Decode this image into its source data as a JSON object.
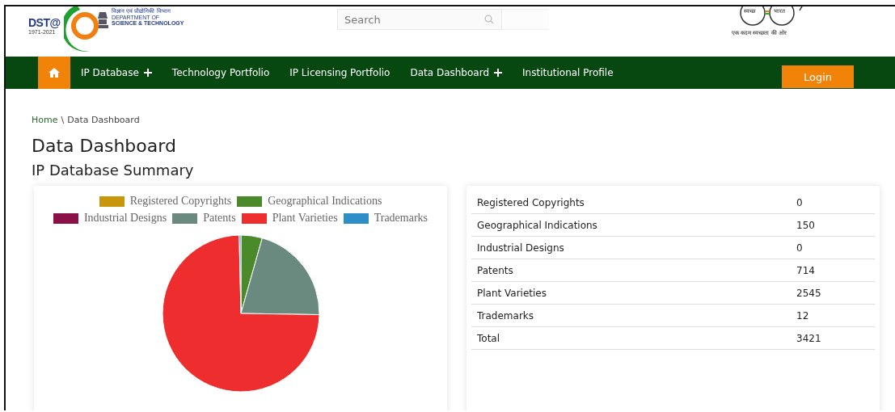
{
  "header": {
    "logo": {
      "badge": "DST@",
      "years": "1971-2021",
      "hindi": "विज्ञान एवं प्रौद्योगिकी विभाग",
      "line1": "DEPARTMENT OF",
      "line2": "SCIENCE & TECHNOLOGY"
    },
    "search": {
      "placeholder": "Search"
    },
    "swachh": {
      "word1": "स्वच्छ",
      "word2": "भारत",
      "tagline": "एक कदम स्वच्छता की ओर"
    }
  },
  "nav": {
    "items": [
      {
        "label": "IP Database",
        "expandable": true
      },
      {
        "label": "Technology Portfolio",
        "expandable": false
      },
      {
        "label": "IP Licensing Portfolio",
        "expandable": false
      },
      {
        "label": "Data Dashboard",
        "expandable": true
      },
      {
        "label": "Institutional Profile",
        "expandable": false
      }
    ],
    "login": "Login"
  },
  "breadcrumb": {
    "home": "Home",
    "separator": "\\",
    "current": "Data Dashboard"
  },
  "title": "Data Dashboard",
  "subtitle": "IP Database Summary",
  "chart": {
    "chart_data": {
      "type": "pie",
      "categories": [
        "Registered Copyrights",
        "Geographical Indications",
        "Industrial Designs",
        "Patents",
        "Plant Varieties",
        "Trademarks"
      ],
      "values": [
        0,
        4.38,
        0,
        20.87,
        74.4,
        0.35
      ],
      "colors": [
        "#c8960c",
        "#4a8a2a",
        "#8b1048",
        "#6a8a80",
        "#ee2e2e",
        "#2e8ec8"
      ]
    }
  },
  "table": {
    "rows": [
      {
        "label": "Registered Copyrights",
        "value": "0"
      },
      {
        "label": "Geographical Indications",
        "value": "150"
      },
      {
        "label": "Industrial Designs",
        "value": "0"
      },
      {
        "label": "Patents",
        "value": "714"
      },
      {
        "label": "Plant Varieties",
        "value": "2545"
      },
      {
        "label": "Trademarks",
        "value": "12"
      },
      {
        "label": "Total",
        "value": "3421"
      }
    ]
  }
}
